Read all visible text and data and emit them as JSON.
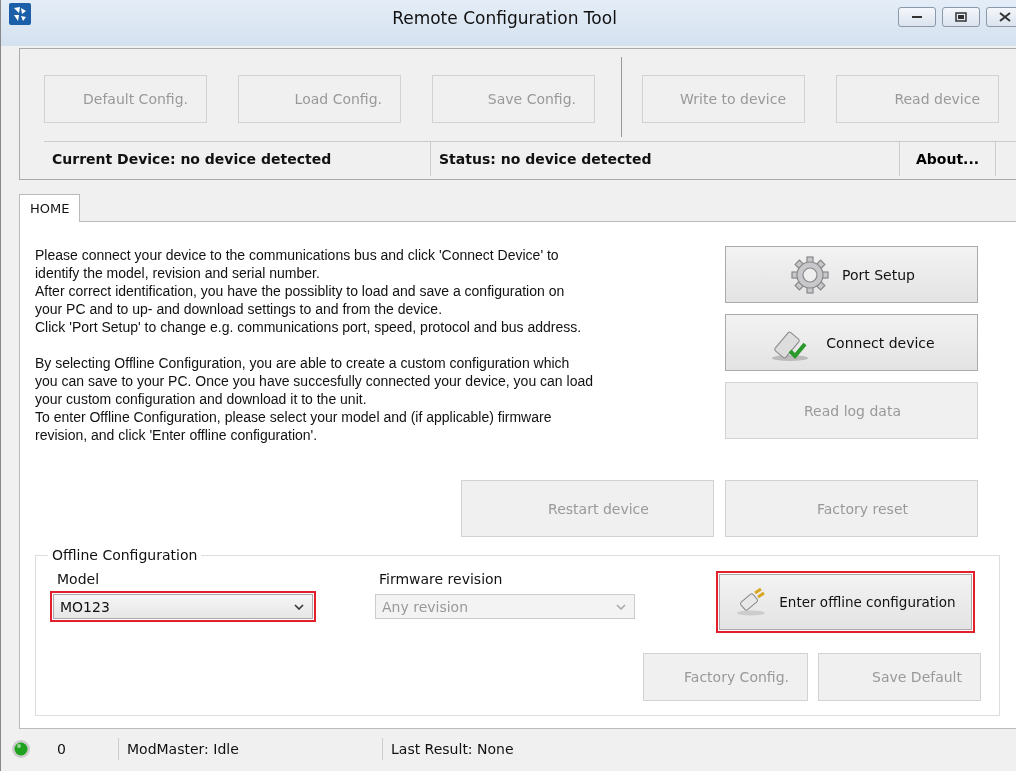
{
  "window": {
    "title": "Remote Configuration Tool"
  },
  "toolbar": {
    "groups": [
      [
        {
          "label": "Default Config.",
          "disabled": true
        },
        {
          "label": "Load Config.",
          "disabled": true
        },
        {
          "label": "Save Config.",
          "disabled": true
        }
      ],
      [
        {
          "label": "Write to device",
          "disabled": true
        },
        {
          "label": "Read device",
          "disabled": true
        }
      ]
    ],
    "current_device": "Current Device: no device detected",
    "status": "Status: no device detected",
    "about": "About..."
  },
  "tabs": [
    {
      "label": "HOME",
      "selected": true
    }
  ],
  "intro": [
    "Please connect your device to the communications bus and click 'Connect Device' to\nidentify the model, revision and serial number.\nAfter correct identification, you have the possiblity to load and save a configuration on\nyour PC and to up- and download settings to and from the device.\nClick 'Port Setup' to change e.g. communications port, speed, protocol and bus address.",
    "By selecting Offline Configuration, you are able to create a custom configuration which\nyou can save to your PC. Once you have succesfully connected your device, you can load\nyour custom configuration and download it to the unit.\nTo enter Offline Configuration, please select your model and (if applicable) firmware\nrevision, and click 'Enter offline configuration'."
  ],
  "side_buttons": [
    {
      "label": "Port Setup",
      "kind": "gear",
      "disabled": false
    },
    {
      "label": "Connect device",
      "kind": "connect",
      "disabled": false
    },
    {
      "label": "Read log data",
      "kind": "plain",
      "disabled": true
    }
  ],
  "device_buttons": [
    {
      "label": "Restart device",
      "disabled": true
    },
    {
      "label": "Factory reset",
      "disabled": true
    }
  ],
  "offline": {
    "title": "Offline Configuration",
    "model": {
      "label": "Model",
      "value": "MO123",
      "disabled": false,
      "highlighted": true
    },
    "firmware": {
      "label": "Firmware revision",
      "value": "Any revision",
      "disabled": true,
      "highlighted": false
    },
    "enter": {
      "label": "Enter offline configuration",
      "disabled": false,
      "highlighted": true
    },
    "buttons": [
      {
        "label": "Factory Config.",
        "disabled": true
      },
      {
        "label": "Save Default",
        "disabled": true
      }
    ]
  },
  "status_bar": {
    "led_on": true,
    "count": "0",
    "state": "ModMaster: Idle",
    "result": "Last Result: None"
  }
}
